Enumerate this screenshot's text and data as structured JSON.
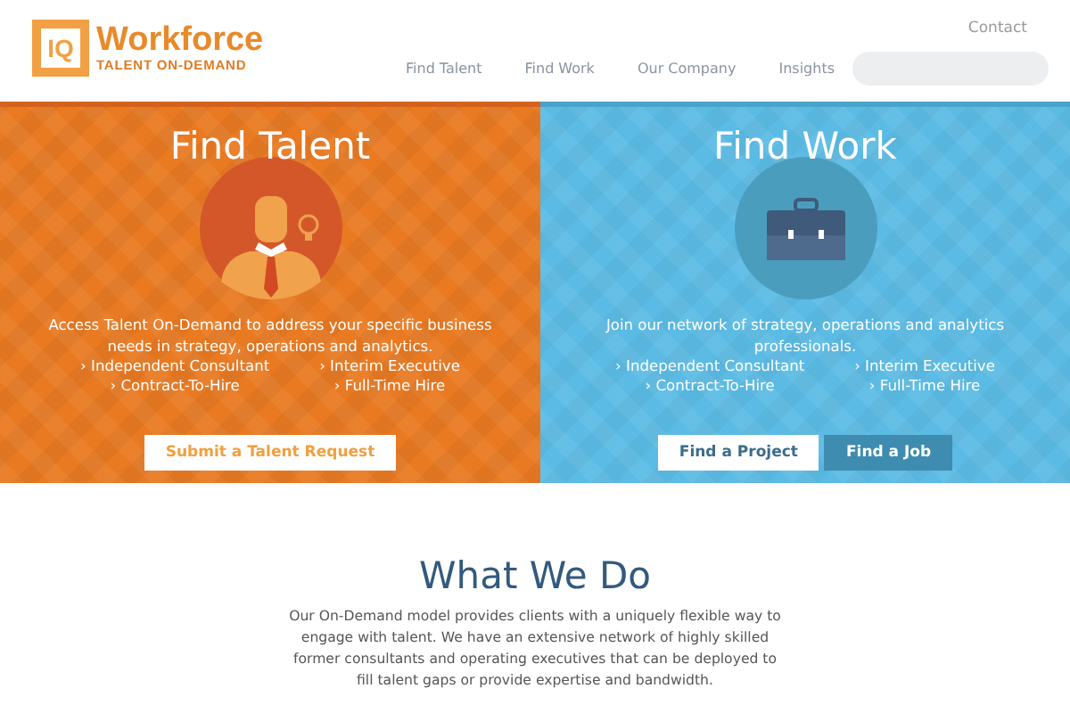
{
  "logo": {
    "mark": "IQ",
    "name": "Workforce",
    "tagline": "TALENT ON-DEMAND"
  },
  "top_link": "Contact",
  "nav": [
    "Find Talent",
    "Find Work",
    "Our Company",
    "Insights"
  ],
  "panels": [
    {
      "kind": "talent",
      "title": "Find Talent",
      "text": "Access Talent On-Demand to address your specific business needs in strategy, operations and analytics.",
      "links": [
        "› Independent Consultant",
        "› Interim Executive",
        "› Contract-To-Hire",
        "› Full-Time Hire"
      ],
      "buttons": [
        {
          "label": "Submit a Talent Request",
          "kind": "light"
        }
      ]
    },
    {
      "kind": "work",
      "title": "Find Work",
      "text": "Join our network of strategy, operations and analytics professionals.",
      "links": [
        "› Independent Consultant",
        "› Interim Executive",
        "› Contract-To-Hire",
        "› Full-Time Hire"
      ],
      "buttons": [
        {
          "label": "Find a Project",
          "kind": "light"
        },
        {
          "label": "Find a Job",
          "kind": "dark"
        }
      ]
    }
  ],
  "about": {
    "title": "What We Do",
    "text": "Our On-Demand model provides clients with a uniquely flexible way to engage with talent. We have an extensive network of highly skilled former consultants and operating executives that can be deployed to fill talent gaps or provide expertise and bandwidth."
  }
}
